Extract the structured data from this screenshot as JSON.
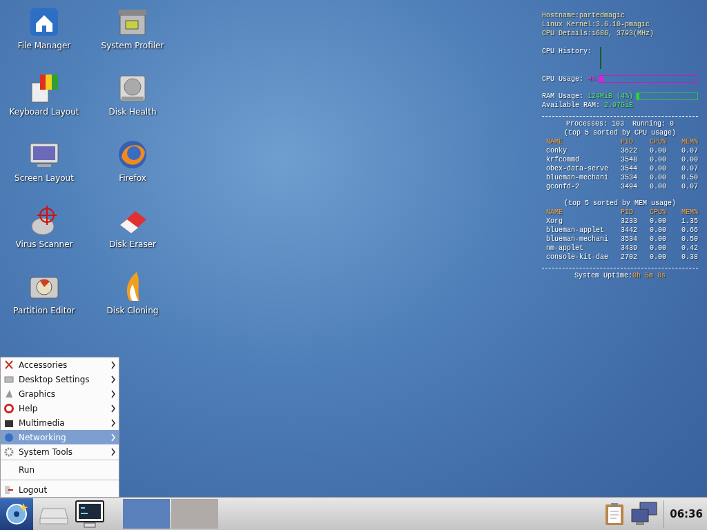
{
  "desktop_icons": [
    {
      "label": "File Manager"
    },
    {
      "label": "System Profiler"
    },
    {
      "label": "Keyboard Layout"
    },
    {
      "label": "Disk Health"
    },
    {
      "label": "Screen Layout"
    },
    {
      "label": "Firefox"
    },
    {
      "label": "Virus Scanner"
    },
    {
      "label": "Disk Eraser"
    },
    {
      "label": "Partition Editor"
    },
    {
      "label": "Disk Cloning"
    }
  ],
  "conky": {
    "info": [
      {
        "label": "Hostname:",
        "value": "partedmagic"
      },
      {
        "label": "Linux Kernel:",
        "value": "3.6.10-pmagic"
      },
      {
        "label": "CPU Details:",
        "value": "i686, 3793(MHz)"
      }
    ],
    "cpu_history_label": "CPU History:",
    "cpu_usage": {
      "label": "CPU Usage:",
      "value": "4%",
      "level": 0.04
    },
    "ram_usage": {
      "label": "RAM Usage:",
      "value": "124MiB (4%)",
      "level": 0.04
    },
    "available_ram": {
      "label": "Available RAM:",
      "value": "2.97GiB"
    },
    "processes": "Processes: 103  Running: 0",
    "tables": [
      {
        "title": "(top 5 sorted by CPU usage)",
        "columns": [
          "NAME",
          "PID",
          "CPU%",
          "MEM%"
        ],
        "rows": [
          [
            "conky",
            "3622",
            "0.00",
            "0.07"
          ],
          [
            "krfcommd",
            "3548",
            "0.00",
            "0.00"
          ],
          [
            "obex-data-serve",
            "3544",
            "0.00",
            "0.07"
          ],
          [
            "blueman-mechani",
            "3534",
            "0.00",
            "0.50"
          ],
          [
            "gconfd-2",
            "3494",
            "0.00",
            "0.07"
          ]
        ]
      },
      {
        "title": "(top 5 sorted by MEM usage)",
        "columns": [
          "NAME",
          "PID",
          "CPU%",
          "MEM%"
        ],
        "rows": [
          [
            "Xorg",
            "3233",
            "0.00",
            "1.35"
          ],
          [
            "blueman-applet",
            "3442",
            "0.00",
            "0.66"
          ],
          [
            "blueman-mechani",
            "3534",
            "0.00",
            "0.50"
          ],
          [
            "nm-applet",
            "3439",
            "0.00",
            "0.42"
          ],
          [
            "console-kit-dae",
            "2702",
            "0.00",
            "0.38"
          ]
        ]
      }
    ],
    "uptime": {
      "label": "System Uptime:",
      "value": "0h 5m 8s"
    }
  },
  "menu": [
    {
      "label": "Accessories",
      "kind": "submenu",
      "selected": false
    },
    {
      "label": "Desktop Settings",
      "kind": "submenu",
      "selected": false
    },
    {
      "label": "Graphics",
      "kind": "submenu",
      "selected": false
    },
    {
      "label": "Help",
      "kind": "submenu",
      "selected": false
    },
    {
      "label": "Multimedia",
      "kind": "submenu",
      "selected": false
    },
    {
      "label": "Networking",
      "kind": "submenu",
      "selected": true
    },
    {
      "label": "System Tools",
      "kind": "submenu",
      "selected": false
    },
    {
      "label": "Run",
      "kind": "action",
      "selected": false
    },
    {
      "label": "Logout",
      "kind": "action",
      "selected": false
    }
  ],
  "taskbar": {
    "workspaces": [
      {
        "selected": true
      },
      {
        "selected": false
      }
    ],
    "clock": "06:36"
  }
}
